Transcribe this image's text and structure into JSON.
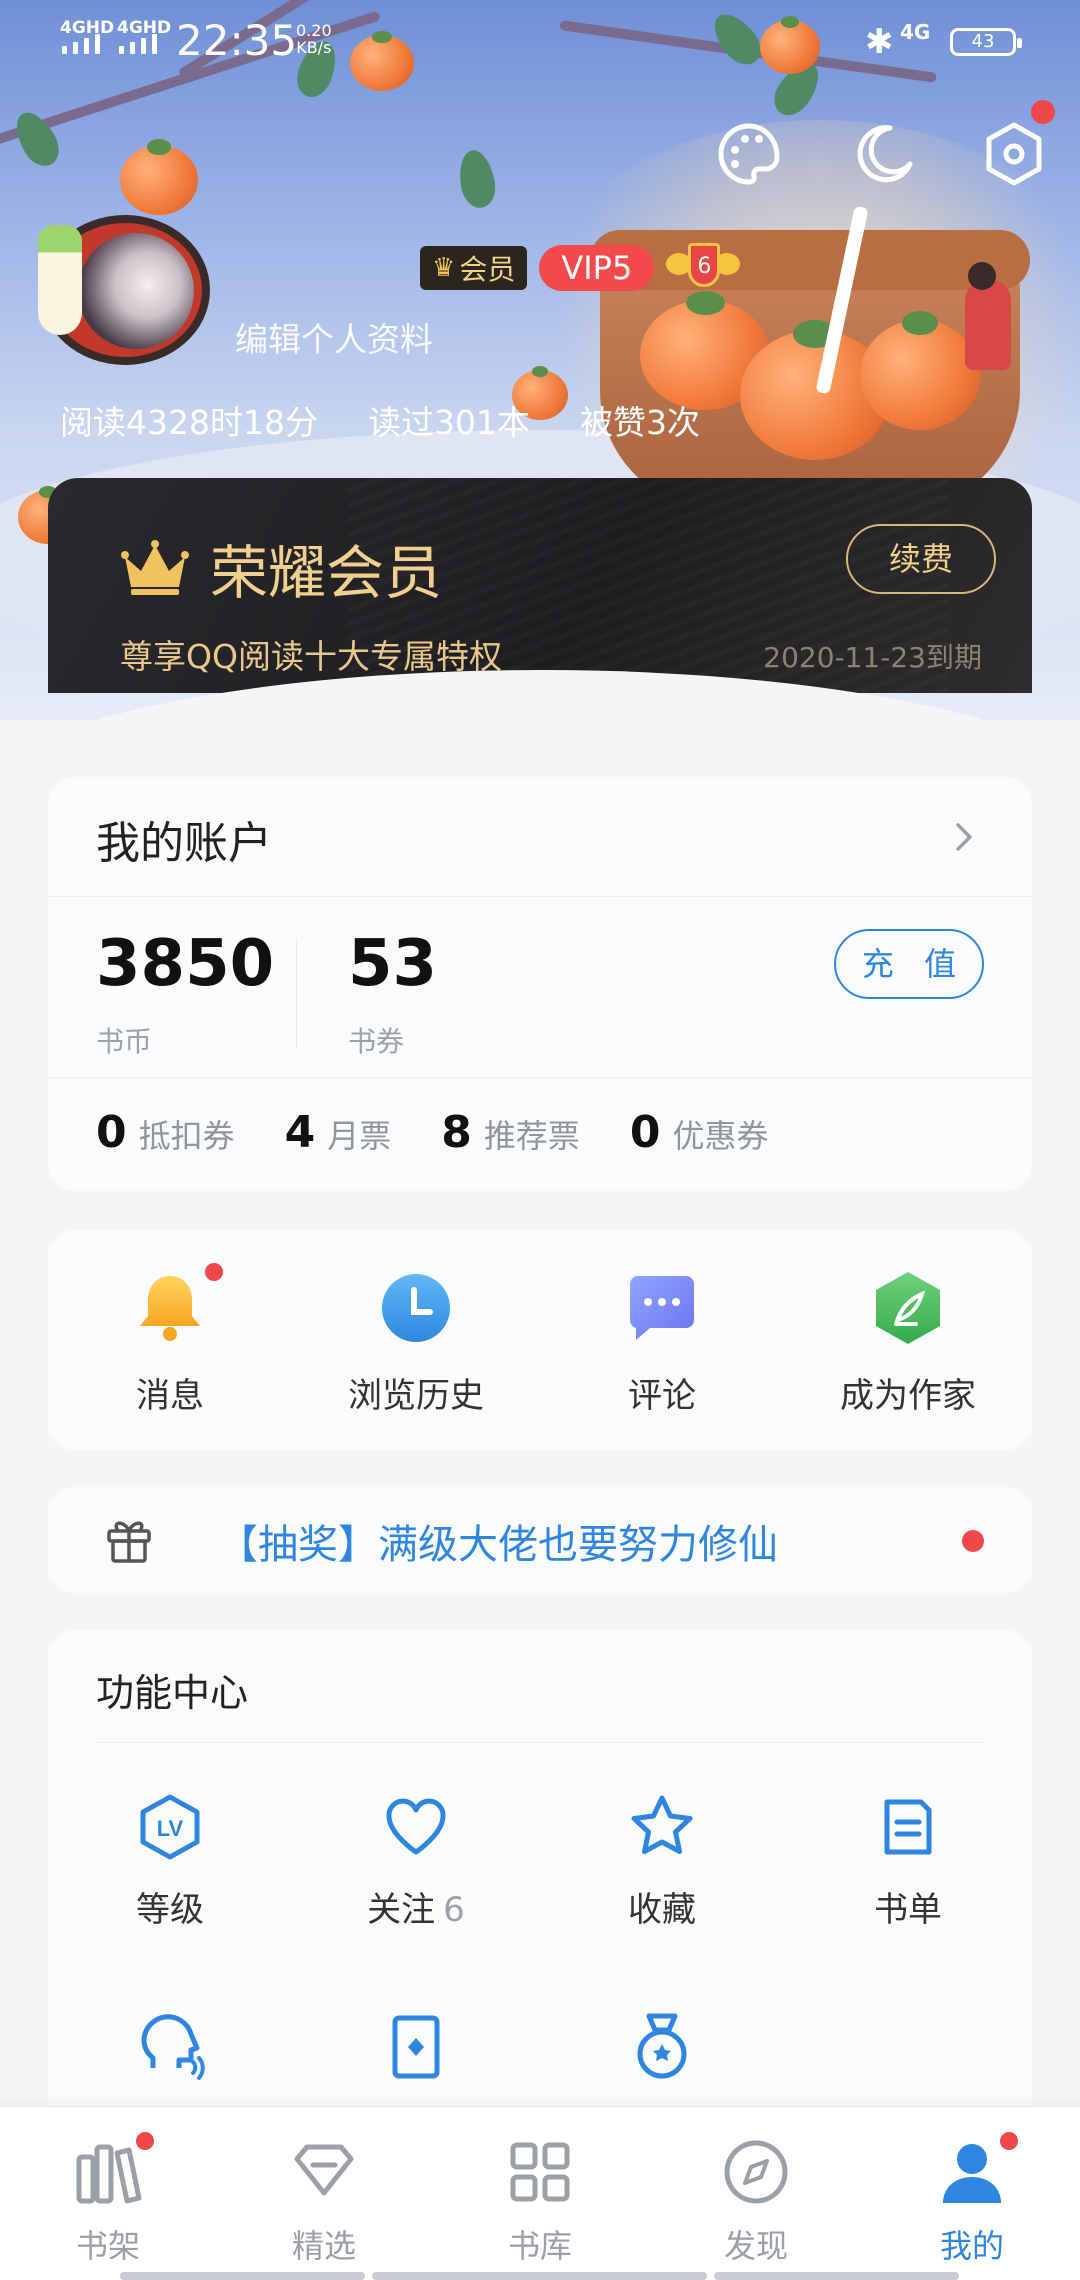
{
  "status_bar": {
    "signal1": "4GHD",
    "signal2": "4GHD",
    "time": "22:35",
    "speed_value": "0.20",
    "speed_unit": "KB/s",
    "network": "4G",
    "battery": "43"
  },
  "header": {
    "icons": [
      "palette-icon",
      "moon-icon",
      "settings-hex-icon"
    ],
    "member_badge": "会员",
    "vip_badge": "VIP5",
    "level_badge": "6",
    "edit_profile": "编辑个人资料",
    "stats": {
      "read_time": "阅读4328时18分",
      "books_read": "读过301本",
      "likes": "被赞3次"
    }
  },
  "vip_card": {
    "title": "荣耀会员",
    "subtitle": "尊享QQ阅读十大专属特权",
    "renew": "续费",
    "expire": "2020-11-23到期"
  },
  "account": {
    "title": "我的账户",
    "coins": "3850",
    "coins_label": "书币",
    "vouchers": "53",
    "vouchers_label": "书券",
    "recharge": "充 值",
    "tickets": [
      {
        "num": "0",
        "label": "抵扣券"
      },
      {
        "num": "4",
        "label": "月票"
      },
      {
        "num": "8",
        "label": "推荐票"
      },
      {
        "num": "0",
        "label": "优惠券"
      }
    ]
  },
  "quick": [
    {
      "label": "消息",
      "icon": "bell-icon"
    },
    {
      "label": "浏览历史",
      "icon": "clock-icon"
    },
    {
      "label": "评论",
      "icon": "comment-icon"
    },
    {
      "label": "成为作家",
      "icon": "quill-icon"
    }
  ],
  "lottery": {
    "text": "【抽奖】满级大佬也要努力修仙"
  },
  "func_center": {
    "title": "功能中心",
    "items": [
      {
        "label": "等级",
        "count": "",
        "icon": "level-icon"
      },
      {
        "label": "关注",
        "count": "6",
        "icon": "heart-icon"
      },
      {
        "label": "收藏",
        "count": "",
        "icon": "star-icon"
      },
      {
        "label": "书单",
        "count": "",
        "icon": "booklist-icon"
      }
    ]
  },
  "tabs": [
    {
      "label": "书架",
      "icon": "bookshelf-icon"
    },
    {
      "label": "精选",
      "icon": "diamond-icon"
    },
    {
      "label": "书库",
      "icon": "grid-icon"
    },
    {
      "label": "发现",
      "icon": "compass-icon"
    },
    {
      "label": "我的",
      "icon": "user-icon"
    }
  ],
  "colors": {
    "accent": "#2f86e0",
    "alert": "#f04848",
    "vip_gold": "#f1cf8e",
    "vip_dark": "#1d1d20"
  }
}
